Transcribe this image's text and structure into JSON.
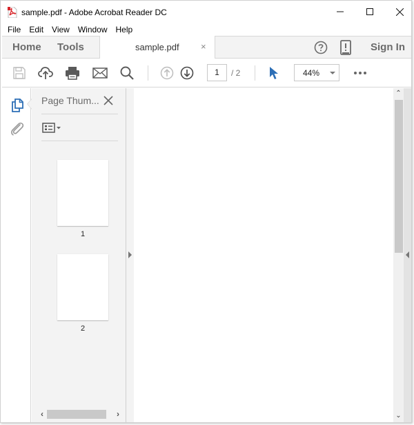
{
  "window": {
    "title": "sample.pdf - Adobe Acrobat Reader DC",
    "app_icon": "pdf-file-icon",
    "controls": {
      "minimize": "—",
      "maximize": "☐",
      "close": "✕"
    }
  },
  "menubar": {
    "items": [
      "File",
      "Edit",
      "View",
      "Window",
      "Help"
    ]
  },
  "tabbar": {
    "home_label": "Home",
    "tools_label": "Tools",
    "document_tab": "sample.pdf",
    "document_tab_close": "×",
    "help_icon": "help-circle-icon",
    "mobile_icon": "mobile-device-icon",
    "sign_in_label": "Sign In"
  },
  "toolbar": {
    "icons": [
      "save-icon",
      "upload-cloud-icon",
      "print-icon",
      "email-icon",
      "search-icon",
      "previous-page-icon",
      "next-page-icon"
    ],
    "current_page": "1",
    "page_total": "/ 2",
    "select_tool_icon": "cursor-arrow-icon",
    "zoom_value": "44%",
    "more_icon": "more-options-icon"
  },
  "left_rail": {
    "items": [
      "page-thumbnails-icon",
      "attachments-icon"
    ],
    "active_color": "#2d6fb6"
  },
  "sidepanel": {
    "title": "Page Thum...",
    "options_icon": "thumbnail-options-icon",
    "thumbnails": [
      {
        "label": "1"
      },
      {
        "label": "2"
      }
    ],
    "scroll_left": "‹",
    "scroll_right": "›"
  },
  "document": {
    "current_page": 1,
    "total_pages": 2
  },
  "scrollbar": {
    "up": "⌃",
    "down": "⌄"
  },
  "colors": {
    "accent_blue": "#2d6fb6",
    "panel_bg": "#f3f3f3",
    "pdf_red": "#d7262b"
  }
}
